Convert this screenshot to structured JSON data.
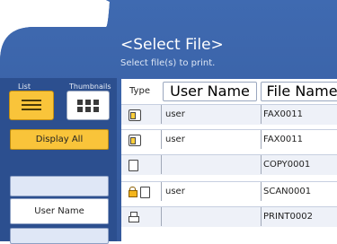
{
  "dialog": {
    "title": "<Select File>",
    "subtitle": "Select file(s) to print."
  },
  "view_tabs": {
    "list_label": "List",
    "thumbnails_label": "Thumbnails",
    "selected": "List"
  },
  "sidebar": {
    "display_all_label": "Display All",
    "user_name_label": "User Name"
  },
  "table": {
    "columns": {
      "type": "Type",
      "user_name": "User Name",
      "file_name": "File Name"
    },
    "rows": [
      {
        "icons": [
          "fax-icon"
        ],
        "user": "user",
        "file": "FAX0011"
      },
      {
        "icons": [
          "fax-icon"
        ],
        "user": "user",
        "file": "FAX0011"
      },
      {
        "icons": [
          "document-icon"
        ],
        "user": "",
        "file": "COPY0001"
      },
      {
        "icons": [
          "lock-icon",
          "document-icon"
        ],
        "user": "user",
        "file": "SCAN0001"
      },
      {
        "icons": [
          "printer-icon"
        ],
        "user": "",
        "file": "PRINT0002"
      }
    ]
  },
  "colors": {
    "panel_blue": "#3a62a6",
    "accent_yellow": "#f9c43a"
  }
}
